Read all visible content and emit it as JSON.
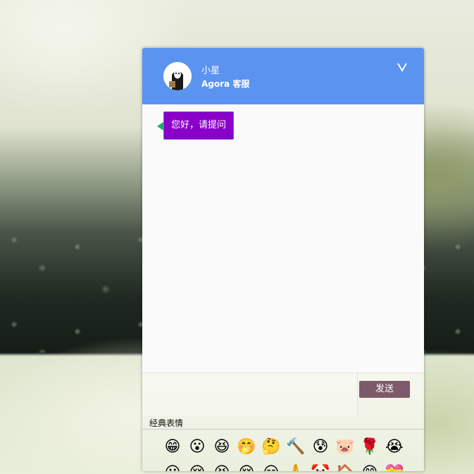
{
  "agent": {
    "name": "小星",
    "role": "Agora 客服"
  },
  "header": {
    "collapse_icon": "chevron-down-icon"
  },
  "messages": [
    {
      "from": "agent",
      "text": "您好，请提问"
    }
  ],
  "composer": {
    "send_label": "发送"
  },
  "emoji_panel": {
    "title": "经典表情",
    "row1": [
      "😁",
      "😮",
      "😆",
      "🤭",
      "🤔",
      "🔨",
      "😰",
      "🐷",
      "🌹",
      "😭"
    ],
    "row2": [
      "😐",
      "😌",
      "😣",
      "😔",
      "😑",
      "🙏",
      "🤡",
      "🏠",
      "😊",
      "💝"
    ]
  },
  "colors": {
    "header_bg": "#5b93f0",
    "bubble_bg": "#8a00c8",
    "send_button_bg": "#7d5a69"
  }
}
